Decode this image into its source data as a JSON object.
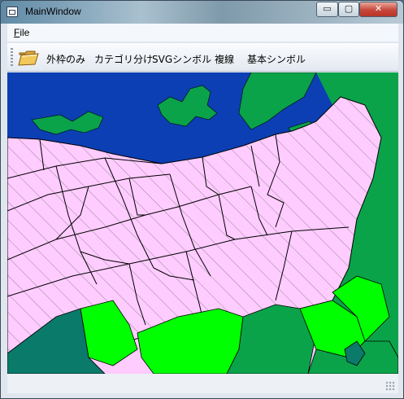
{
  "window": {
    "title": "MainWindow"
  },
  "caption": {
    "minimize": "▭",
    "maximize": "▢",
    "close": "✕"
  },
  "menubar": {
    "file_label": "File"
  },
  "toolbar": {
    "open_icon": "folder-open-icon",
    "buttons": [
      "外枠のみ",
      "カテゴリ分け",
      "SVGシンボル",
      "複線",
      "基本シンボル"
    ]
  },
  "map": {
    "colors": {
      "water": "#0b3fb3",
      "land_green": "#0aa34a",
      "bright_green": "#00ff00",
      "teal": "#0a7a6a",
      "pink": "#ffccff",
      "outline": "#000000"
    }
  }
}
